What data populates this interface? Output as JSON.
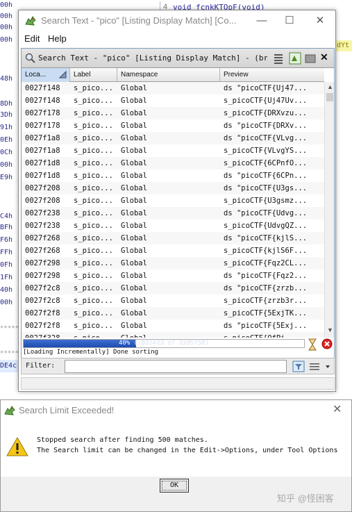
{
  "background": {
    "addr_fragments": [
      "00h",
      "00h",
      "00h",
      "00h",
      "48h",
      "8Dh",
      "3Dh",
      "91h",
      "0Eh",
      "0Ch",
      "00h",
      "E9h",
      "C4h",
      "BFh",
      "F6h",
      "FFh",
      "0Fh",
      "1Fh",
      "40h",
      "00h"
    ],
    "stars_1": "*****",
    "stars_2": "*****",
    "blue_frag": "DE4c",
    "code_line_num": "4",
    "code_text": "void fcnkKTOpF(void)",
    "yellow_frag": "dYt"
  },
  "window": {
    "title": "Search Text - \"pico\"  [Listing Display Match] [Co...",
    "min": "—",
    "max": "☐",
    "close": "✕"
  },
  "menu": {
    "edit": "Edit",
    "help": "Help"
  },
  "panel": {
    "title": "Search Text - \"pico\"  [Listing Display Match] - (bre...",
    "close": "✕"
  },
  "table": {
    "headers": {
      "location": "Loca...",
      "label": "Label",
      "namespace": "Namespace",
      "preview": "Preview"
    },
    "rows": [
      {
        "loc": "0027f148",
        "label": "s_pico...",
        "ns": "Global",
        "preview": "ds \"picoCTF{Uj47..."
      },
      {
        "loc": "0027f148",
        "label": "s_pico...",
        "ns": "Global",
        "preview": "s_picoCTF{Uj47Uv..."
      },
      {
        "loc": "0027f178",
        "label": "s_pico...",
        "ns": "Global",
        "preview": "s_picoCTF{DRXvzu..."
      },
      {
        "loc": "0027f178",
        "label": "s_pico...",
        "ns": "Global",
        "preview": "ds \"picoCTF{DRXv..."
      },
      {
        "loc": "0027f1a8",
        "label": "s_pico...",
        "ns": "Global",
        "preview": "ds \"picoCTF{VLvg..."
      },
      {
        "loc": "0027f1a8",
        "label": "s_pico...",
        "ns": "Global",
        "preview": "s_picoCTF{VLvgYS..."
      },
      {
        "loc": "0027f1d8",
        "label": "s_pico...",
        "ns": "Global",
        "preview": "s_picoCTF{6CPnfO..."
      },
      {
        "loc": "0027f1d8",
        "label": "s_pico...",
        "ns": "Global",
        "preview": "ds \"picoCTF{6CPn..."
      },
      {
        "loc": "0027f208",
        "label": "s_pico...",
        "ns": "Global",
        "preview": "ds \"picoCTF{U3gs..."
      },
      {
        "loc": "0027f208",
        "label": "s_pico...",
        "ns": "Global",
        "preview": "s_picoCTF{U3gsmz..."
      },
      {
        "loc": "0027f238",
        "label": "s_pico...",
        "ns": "Global",
        "preview": "ds \"picoCTF{Udvg..."
      },
      {
        "loc": "0027f238",
        "label": "s_pico...",
        "ns": "Global",
        "preview": "s_picoCTF{UdvgQZ..."
      },
      {
        "loc": "0027f268",
        "label": "s_pico...",
        "ns": "Global",
        "preview": "ds \"picoCTF{kjlS..."
      },
      {
        "loc": "0027f268",
        "label": "s_pico...",
        "ns": "Global",
        "preview": "s_picoCTF{kjlS6F..."
      },
      {
        "loc": "0027f298",
        "label": "s_pico...",
        "ns": "Global",
        "preview": "s_picoCTF{Fqz2CL..."
      },
      {
        "loc": "0027f298",
        "label": "s_pico...",
        "ns": "Global",
        "preview": "ds \"picoCTF{Fqz2..."
      },
      {
        "loc": "0027f2c8",
        "label": "s_pico...",
        "ns": "Global",
        "preview": "ds \"picoCTF{zrzb..."
      },
      {
        "loc": "0027f2c8",
        "label": "s_pico...",
        "ns": "Global",
        "preview": "s_picoCTF{zrzb3r..."
      },
      {
        "loc": "0027f2f8",
        "label": "s_pico...",
        "ns": "Global",
        "preview": "s_picoCTF{5ExjTK..."
      },
      {
        "loc": "0027f2f8",
        "label": "s_pico...",
        "ns": "Global",
        "preview": "ds \"picoCTF{5Exj..."
      },
      {
        "loc": "0027f328",
        "label": "s_pico...",
        "ns": "Global",
        "preview": "s_picoCTF{QfPi..."
      }
    ]
  },
  "progress": {
    "fraction": 0.4,
    "text": "40% (1031423 of 2595758)",
    "status": "[Loading Incrementally] Done sorting"
  },
  "filter": {
    "label": "Filter:",
    "value": ""
  },
  "dialog": {
    "title": "Search Limit Exceeded!",
    "close": "✕",
    "line1": "Stopped search after finding 500 matches.",
    "line2": "The Search limit can be changed in the Edit->Options, under Tool Options",
    "ok": "OK"
  },
  "watermark": "知乎 @怪困客",
  "colors": {
    "accent": "#1d4bb0",
    "header_bg": "#e4e4e4",
    "selected_header": "#c9dcf2"
  }
}
